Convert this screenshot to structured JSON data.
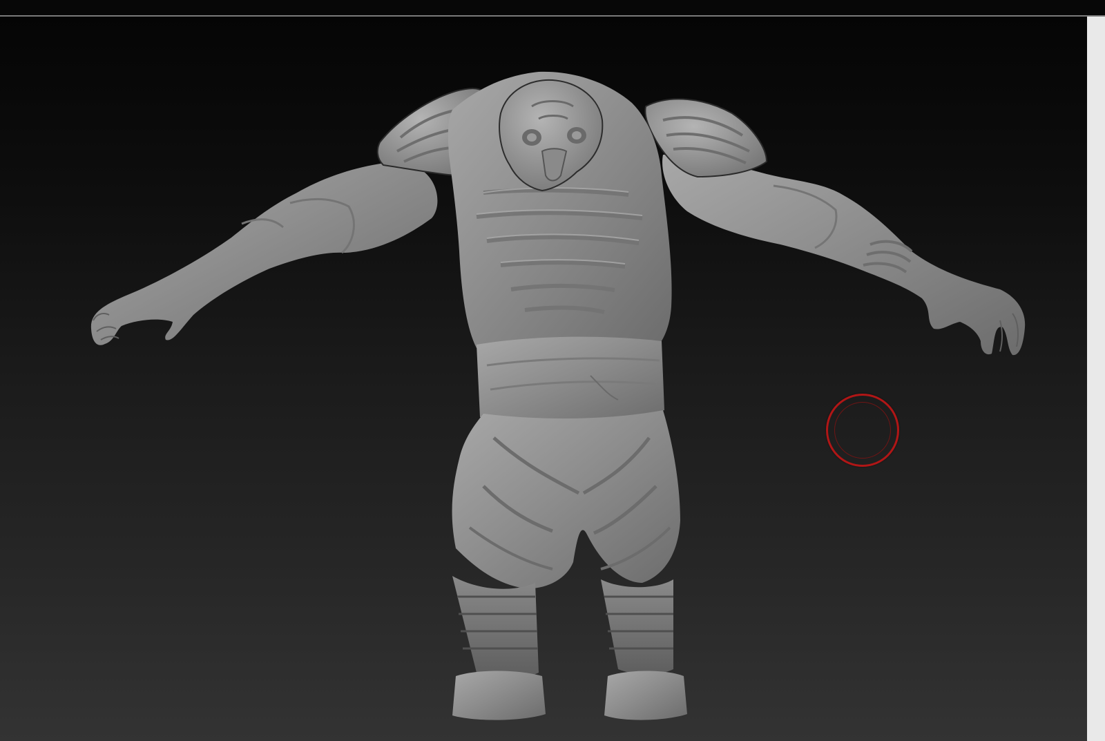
{
  "app": {
    "background_top_color": "#050505",
    "background_bottom_color": "#333333",
    "separator_color": "#7a7a7a"
  },
  "canvas": {
    "model_icon": "sculpted-character-model",
    "model_color": "#8c8c8c"
  },
  "cursor": {
    "icon": "brush-circle-cursor",
    "color": "#b01616"
  }
}
